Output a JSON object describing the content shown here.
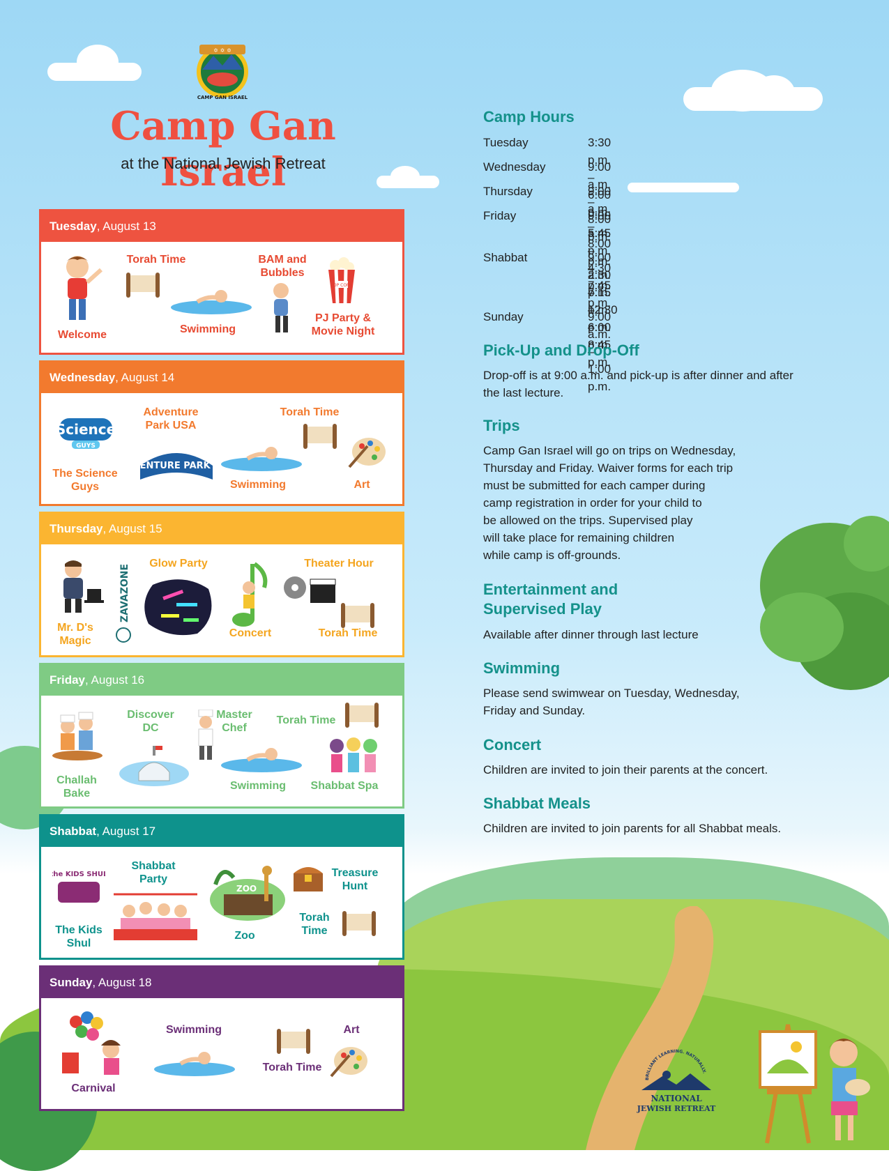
{
  "header": {
    "title": "Camp Gan Israel",
    "subtitle": "at the National Jewish Retreat",
    "logo_text": "CAMP GAN ISRAEL"
  },
  "colors": {
    "tuesday": "#ee5340",
    "wednesday": "#f27a2e",
    "thursday": "#fbb531",
    "friday": "#7fcb84",
    "shabbat": "#0e928c",
    "sunday": "#6b2f77",
    "section_heading": "#14918a"
  },
  "days": [
    {
      "day": "Tuesday",
      "date": ", August 13",
      "activities": [
        "Welcome",
        "Torah Time",
        "Swimming",
        "BAM and Bubbles",
        "PJ Party & Movie Night"
      ]
    },
    {
      "day": "Wednesday",
      "date": ", August 14",
      "activities": [
        "The Science Guys",
        "Adventure Park USA",
        "Swimming",
        "Torah Time",
        "Art"
      ]
    },
    {
      "day": "Thursday",
      "date": ", August 15",
      "activities": [
        "Mr. D's Magic",
        "Glow Party",
        "Concert",
        "Theater Hour",
        "Torah Time"
      ]
    },
    {
      "day": "Friday",
      "date": ", August 16",
      "activities": [
        "Challah Bake",
        "Discover DC",
        "Master Chef",
        "Swimming",
        "Torah Time",
        "Shabbat Spa"
      ]
    },
    {
      "day": "Shabbat",
      "date": ", August 17",
      "activities": [
        "The Kids Shul",
        "Shabbat Party",
        "Zoo",
        "Treasure Hunt",
        "Torah Time"
      ]
    },
    {
      "day": "Sunday",
      "date": ", August 18",
      "activities": [
        "Carnival",
        "Swimming",
        "Torah Time",
        "Art"
      ]
    }
  ],
  "logos": {
    "science": "Science",
    "science_sub": "GUYS",
    "adventure": "ADVENTURE PARK USA",
    "zavazone": "ZAVAZONE",
    "kids_shul": "the KIDS SHUL",
    "popcorn": "POP CORN",
    "zoo": "ZOO"
  },
  "camp_hours": {
    "heading": "Camp Hours",
    "rows": [
      {
        "day": "Tuesday",
        "times": [
          "3:30 p.m. – 6:00 p.m."
        ]
      },
      {
        "day": "Wednesday",
        "times": [
          "9:00 a.m. – 8:00 p.m."
        ]
      },
      {
        "day": "Thursday",
        "times": [
          "9:00 a.m. – 8:00 p.m."
        ]
      },
      {
        "day": "Friday",
        "times": [
          "9:00 a.m. – 4:30 p.m.",
          "5:45 p.m. – 7:45 p.m."
        ]
      },
      {
        "day": "Shabbat",
        "times": [
          "9:00 a.m. – 12:30 p.m.",
          "2:30 p.m. – 6:00 p.m.",
          "7:15 p.m. – 8:45 p.m."
        ]
      },
      {
        "day": "Sunday",
        "times": [
          "9:00 a.m. – 1:00 p.m."
        ]
      }
    ]
  },
  "sections": {
    "pickup": {
      "heading": "Pick-Up and Drop-Off",
      "lines": [
        "Drop-off is at 9:00 a.m. and pick-up is after dinner and after",
        "the last lecture."
      ]
    },
    "trips": {
      "heading": "Trips",
      "lines": [
        "Camp Gan Israel will go on trips on Wednesday,",
        "Thursday and Friday. Waiver forms for each trip",
        "must be submitted for each camper during",
        "camp registration in order for your child to",
        "be allowed on the trips. Supervised play",
        "will take place for remaining children",
        "while camp is off-grounds."
      ]
    },
    "entertainment": {
      "heading1": "Entertainment and",
      "heading2": "Supervised Play",
      "lines": [
        "Available after dinner through last lecture"
      ]
    },
    "swimming": {
      "heading": "Swimming",
      "lines": [
        "Please send swimwear on Tuesday, Wednesday,",
        "Friday and Sunday."
      ]
    },
    "concert": {
      "heading": "Concert",
      "lines": [
        "Children are invited to join their parents at the concert."
      ]
    },
    "meals": {
      "heading": "Shabbat Meals",
      "lines": [
        "Children are invited to join parents for all Shabbat meals."
      ]
    }
  },
  "footer_logo": {
    "tagline": "BRILLIANT LEARNING. NATURALLY.",
    "line1": "NATIONAL",
    "line2": "JEWISH RETREAT"
  }
}
